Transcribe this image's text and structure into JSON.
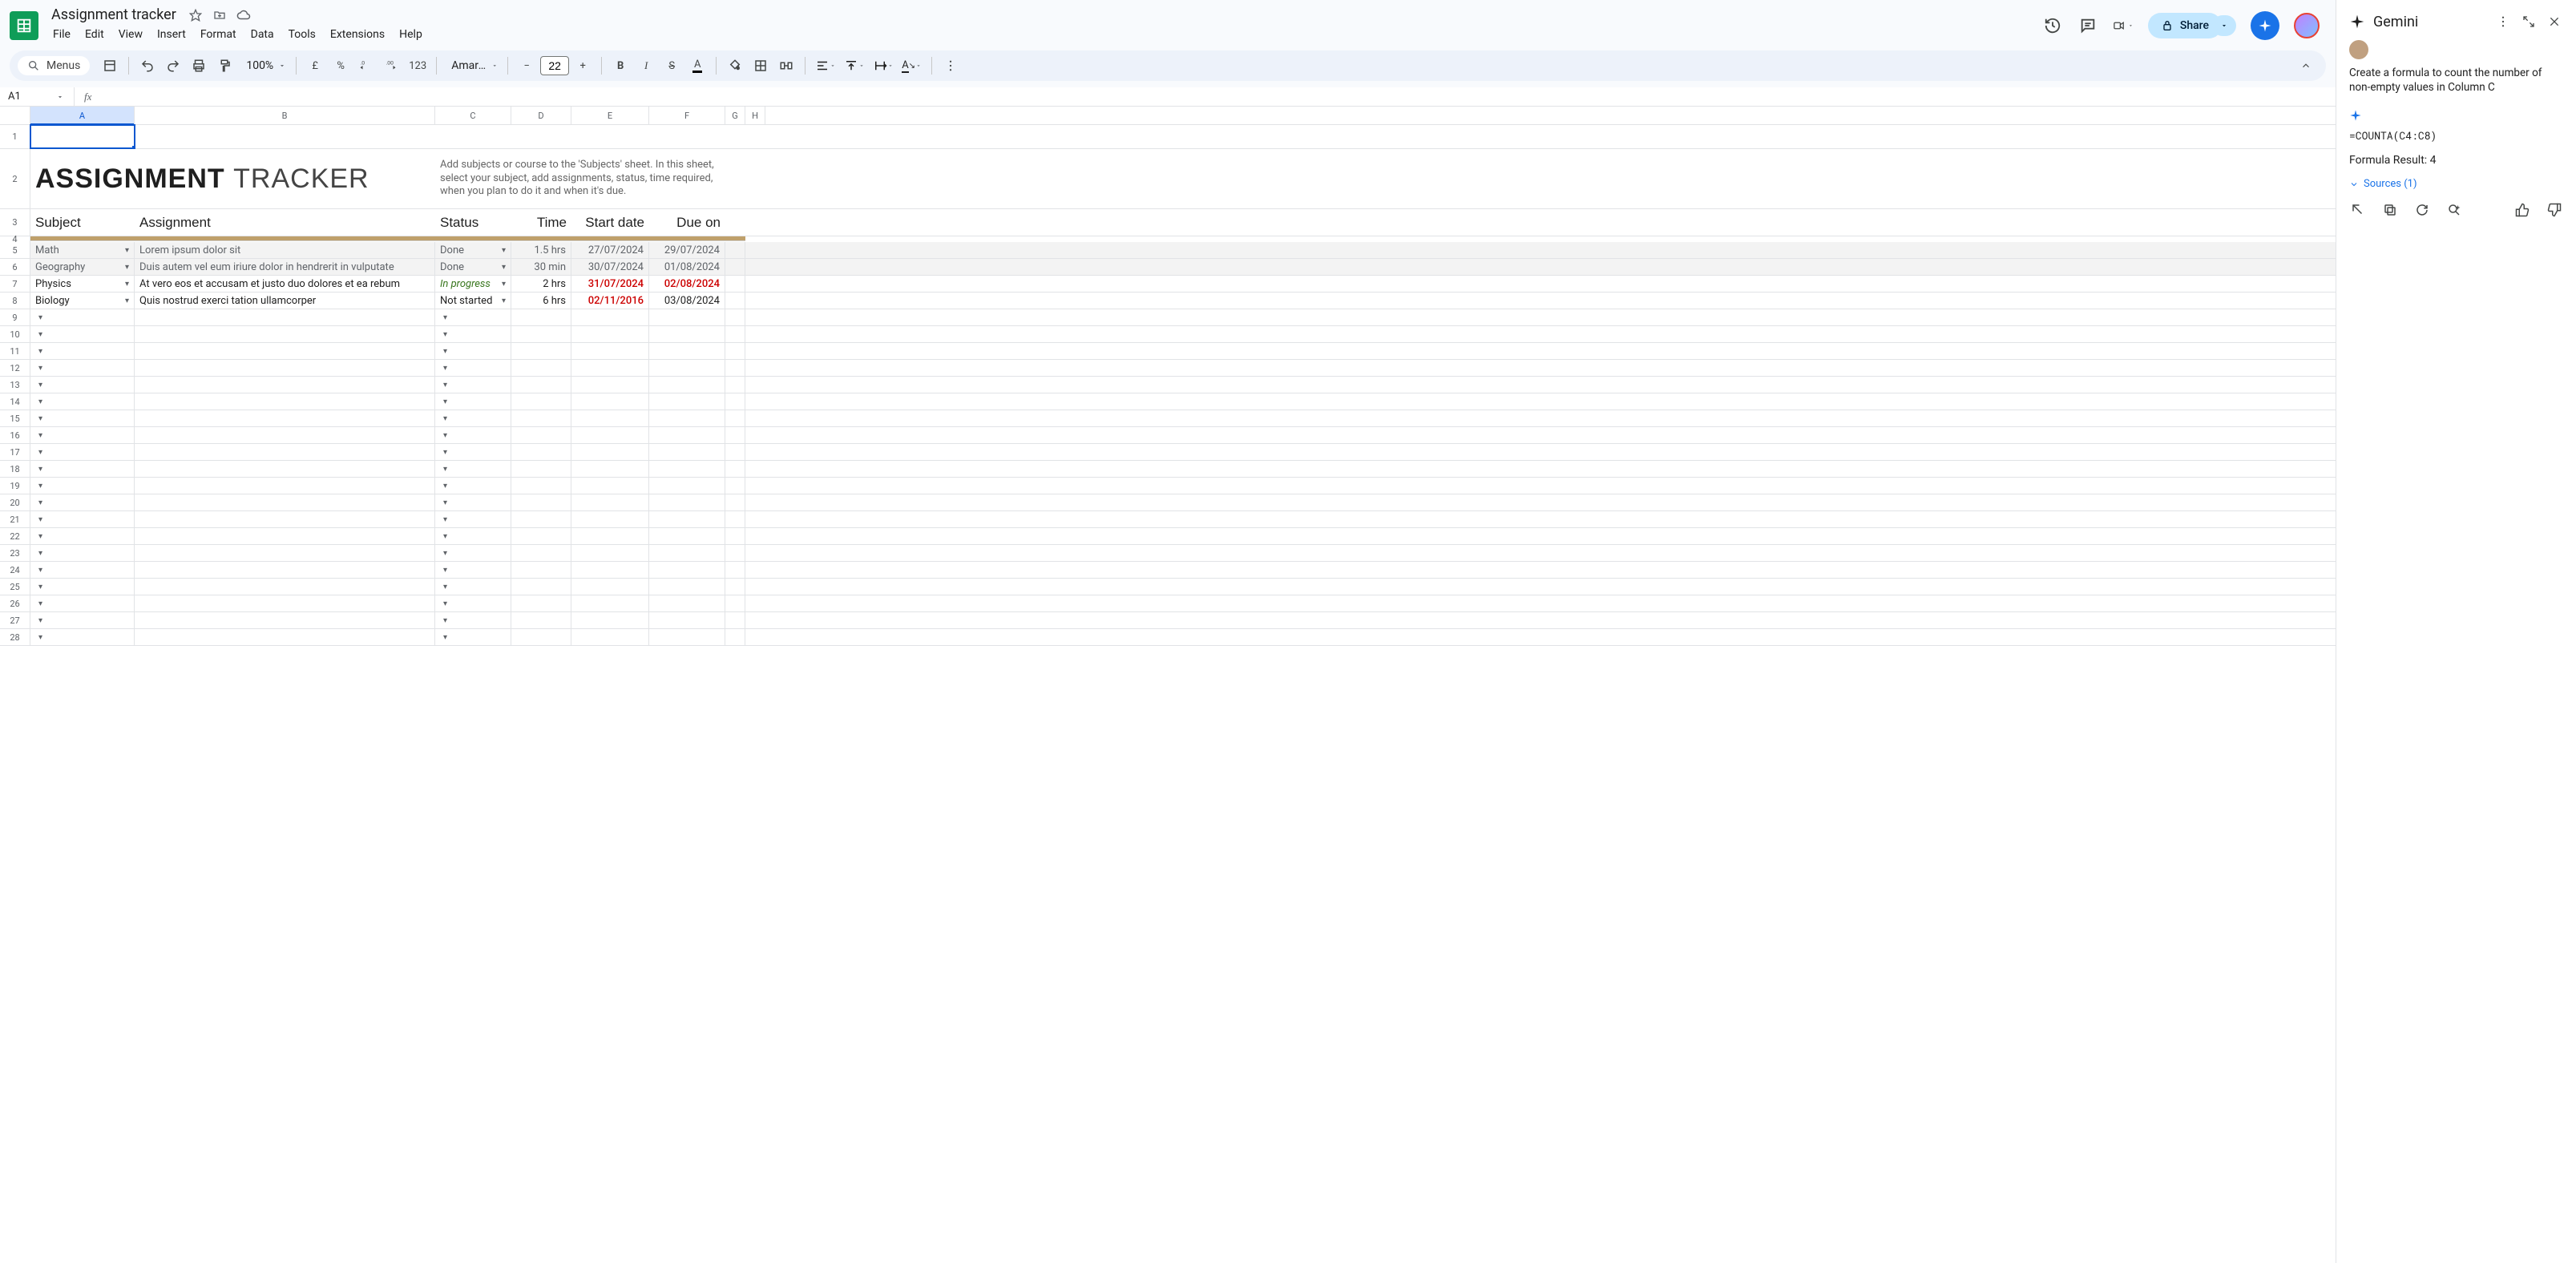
{
  "doc_title": "Assignment tracker",
  "menus": [
    "File",
    "Edit",
    "View",
    "Insert",
    "Format",
    "Data",
    "Tools",
    "Extensions",
    "Help"
  ],
  "toolbar": {
    "search_label": "Menus",
    "zoom": "100%",
    "currency_symbol": "£",
    "percent_symbol": "%",
    "number_sample": "123",
    "font_name": "Amara...",
    "font_size": "22"
  },
  "share_label": "Share",
  "namebox": "A1",
  "formula": "",
  "columns": [
    "A",
    "B",
    "C",
    "D",
    "E",
    "F",
    "G",
    "H"
  ],
  "title_bold": "ASSIGNMENT",
  "title_thin": "TRACKER",
  "instructions": "Add subjects or course to the 'Subjects' sheet. In this sheet, select your subject, add assignments, status, time required, when you plan to do it and when it's due.",
  "headers": {
    "subject": "Subject",
    "assignment": "Assignment",
    "status": "Status",
    "time": "Time",
    "start": "Start date",
    "due": "Due on"
  },
  "rows": [
    {
      "n": 5,
      "subject": "Math",
      "assignment": "Lorem ipsum dolor sit",
      "status": "Done",
      "time": "1.5 hrs",
      "start": "27/07/2024",
      "due": "29/07/2024",
      "gray": true,
      "status_style": "",
      "start_red": false,
      "due_red": false
    },
    {
      "n": 6,
      "subject": "Geography",
      "assignment": "Duis autem vel eum iriure dolor in hendrerit in vulputate",
      "status": "Done",
      "time": "30 min",
      "start": "30/07/2024",
      "due": "01/08/2024",
      "gray": true,
      "status_style": "",
      "start_red": false,
      "due_red": false
    },
    {
      "n": 7,
      "subject": "Physics",
      "assignment": "At vero eos et accusam et justo duo dolores et ea rebum",
      "status": "In progress",
      "time": "2 hrs",
      "start": "31/07/2024",
      "due": "02/08/2024",
      "gray": false,
      "status_style": "greenitalic",
      "start_red": true,
      "due_red": true
    },
    {
      "n": 8,
      "subject": "Biology",
      "assignment": "Quis nostrud exerci tation ullamcorper",
      "status": "Not started",
      "time": "6 hrs",
      "start": "02/11/2016",
      "due": "03/08/2024",
      "gray": false,
      "status_style": "",
      "start_red": true,
      "due_red": false
    }
  ],
  "empty_rows": [
    9,
    10,
    11,
    12,
    13,
    14,
    15,
    16,
    17,
    18,
    19,
    20,
    21,
    22,
    23,
    24,
    25,
    26,
    27,
    28
  ],
  "gemini": {
    "title": "Gemini",
    "prompt": "Create a formula to count the number of non-empty values in Column C",
    "formula": "=COUNTA(C4:C8)",
    "result": "Formula Result: 4",
    "sources": "Sources (1)"
  }
}
